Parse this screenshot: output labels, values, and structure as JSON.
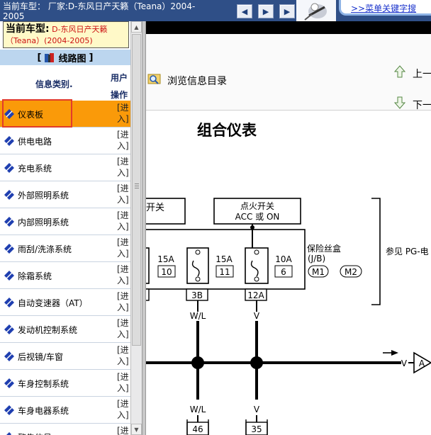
{
  "topbar": {
    "title": "当前车型： 厂家:D-东风日产天籁（Teana）2004-2005",
    "keyword_search": ">>菜单关键字搜",
    "nav_buttons": [
      "◀",
      "▶",
      "▶"
    ]
  },
  "car": {
    "label": "当前车型:",
    "model": "D-东风日产天籁（Teana）(2004-2005)"
  },
  "sidebar": {
    "heading": "线路图",
    "bracket_open": "[",
    "bracket_close": "]",
    "col_category": "信息类别.",
    "col_user_ops": "用户操作",
    "enter_label": "[进入]",
    "items": [
      {
        "label": "仪表板",
        "active": true
      },
      {
        "label": "供电电路",
        "active": false
      },
      {
        "label": "充电系统",
        "active": false
      },
      {
        "label": "外部照明系统",
        "active": false
      },
      {
        "label": "内部照明系统",
        "active": false
      },
      {
        "label": "雨刮/洗涤系统",
        "active": false
      },
      {
        "label": "除霜系统",
        "active": false
      },
      {
        "label": "自动变速器（AT）",
        "active": false
      },
      {
        "label": "发动机控制系统",
        "active": false
      },
      {
        "label": "后视镜/车窗",
        "active": false
      },
      {
        "label": "车身控制系统",
        "active": false
      },
      {
        "label": "车身电器系统",
        "active": false
      },
      {
        "label": "警告信号",
        "active": false
      }
    ]
  },
  "content": {
    "browse_label": "浏览信息目录",
    "prev_label": "上一",
    "next_label": "下一",
    "page_title": "组合仪表"
  },
  "diagram": {
    "left_switch_label": "开关",
    "ignition_line1": "点火开关",
    "ignition_line2": "ACC 或 ON",
    "fuse_box_line1": "保险丝盒",
    "fuse_box_line2": "(J/B)",
    "connector_m1": "M1",
    "connector_m2": "M2",
    "reference": "参见 PG-电",
    "fuses": [
      {
        "rating": "15A",
        "number": "10"
      },
      {
        "rating": "15A",
        "number": "11"
      },
      {
        "rating": "10A",
        "number": "6"
      }
    ],
    "terminal_3b": "3B",
    "terminal_12a": "12A",
    "wire_wl": "W/L",
    "wire_v": "V",
    "wire_v_arrow": "V",
    "connector_a": "A",
    "wire_wl_lower": "W/L",
    "wire_v_lower": "V",
    "terminal_46": "46",
    "terminal_35": "35",
    "colors": {
      "topbar": "#2f4f87",
      "active_row": "#fa9a09",
      "active_frame": "#e23b2c",
      "link": "#1a33cc",
      "car_box": "#fff9c8"
    }
  }
}
